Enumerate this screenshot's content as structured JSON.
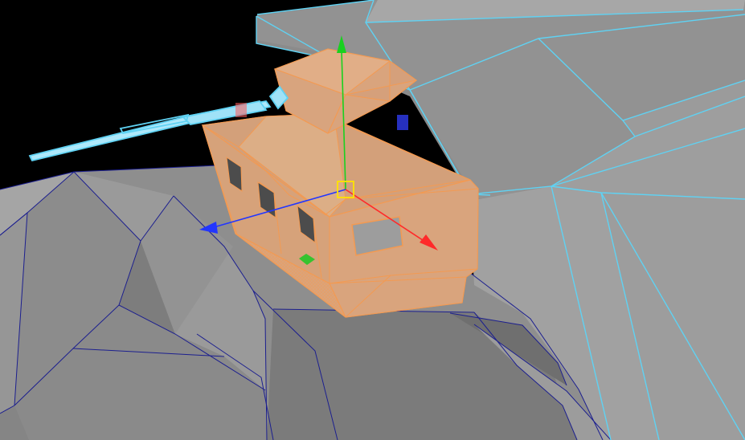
{
  "viewport": {
    "background_color": "#000000",
    "mesh_fill_color": "#8f8f8f",
    "mesh_shade_light": "#a3a3a3",
    "mesh_shade_dark": "#737373",
    "wire_color_unselected": "#1c1f8f",
    "wire_color_highlighted": "#5fd2f3",
    "wire_color_selected": "#f39a52",
    "selected_fill_color": "#d9a47d"
  },
  "gizmo": {
    "x_axis_color": "#ff2a2a",
    "y_axis_color": "#19d11f",
    "z_axis_color": "#2236ff",
    "center_handle_color": "#ffe400",
    "icons": {
      "x": "x-axis-arrow",
      "y": "y-axis-arrow",
      "z": "z-axis-arrow",
      "center": "move-center-handle",
      "xy_plane": "xy-plane-handle",
      "yz_plane": "yz-plane-handle",
      "xz_plane": "xz-plane-handle"
    }
  }
}
